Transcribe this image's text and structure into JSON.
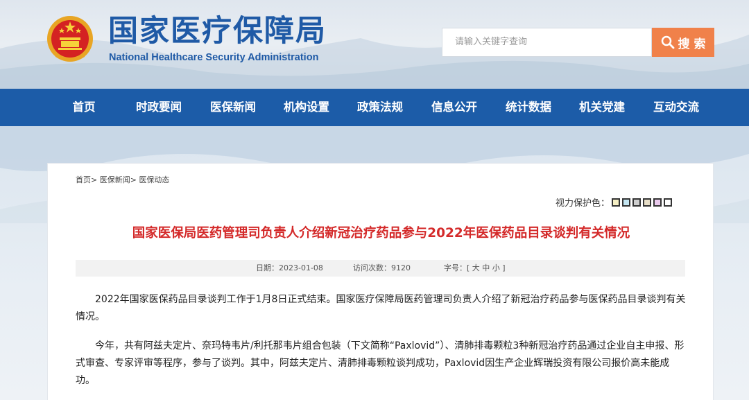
{
  "site": {
    "name_cn": "国家医疗保障局",
    "name_en": "National Healthcare Security Administration"
  },
  "search": {
    "placeholder": "请输入关键字查询",
    "button_label": "搜 索"
  },
  "nav": {
    "items": [
      {
        "label": "首页"
      },
      {
        "label": "时政要闻"
      },
      {
        "label": "医保新闻"
      },
      {
        "label": "机构设置"
      },
      {
        "label": "政策法规"
      },
      {
        "label": "信息公开"
      },
      {
        "label": "统计数据"
      },
      {
        "label": "机关党建"
      },
      {
        "label": "互动交流"
      }
    ]
  },
  "breadcrumb": {
    "items": [
      "首页",
      "医保新闻",
      "医保动态"
    ],
    "separator": ">"
  },
  "vision": {
    "label": "视力保护色：",
    "swatches": [
      "#f5efc4",
      "#c4e6f2",
      "#cfcfcf",
      "#e8dfc8",
      "#e9c9ec",
      "#ffffff"
    ]
  },
  "article": {
    "title": "国家医保局医药管理司负责人介绍新冠治疗药品参与2022年医保药品目录谈判有关情况",
    "date_label": "日期：",
    "date": "2023-01-08",
    "visits_label": "访问次数：",
    "visits": "9120",
    "font_label": "字号：",
    "font_bracket_open": "[",
    "font_large": "大",
    "font_medium": "中",
    "font_small": "小",
    "font_bracket_close": "]",
    "paragraphs": [
      "2022年国家医保药品目录谈判工作于1月8日正式结束。国家医疗保障局医药管理司负责人介绍了新冠治疗药品参与医保药品目录谈判有关情况。",
      "今年，共有阿兹夫定片、奈玛特韦片/利托那韦片组合包装（下文简称“Paxlovid”）、清肺排毒颗粒3种新冠治疗药品通过企业自主申报、形式审查、专家评审等程序，参与了谈判。其中，阿兹夫定片、清肺排毒颗粒谈判成功，Paxlovid因生产企业辉瑞投资有限公司报价高未能成功。"
    ]
  },
  "colors": {
    "brand_blue": "#1c5ca8",
    "title_red": "#d42a2a",
    "search_orange": "#f0814a"
  }
}
